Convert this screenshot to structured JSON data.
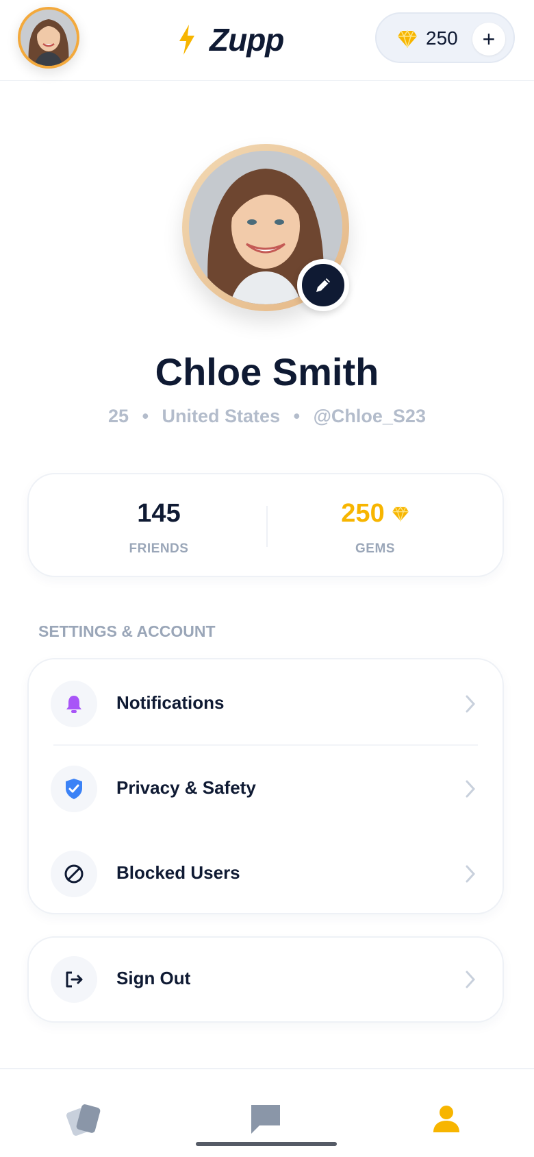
{
  "header": {
    "brand_name": "Zupp",
    "gem_count": "250",
    "add_gems_label": "+"
  },
  "profile": {
    "name": "Chloe Smith",
    "age": "25",
    "country": "United States",
    "handle": "@Chloe_S23",
    "separator": "•"
  },
  "stats": {
    "friends_value": "145",
    "friends_label": "FRIENDS",
    "gems_value": "250",
    "gems_label": "GEMS"
  },
  "settings": {
    "section_title": "SETTINGS & ACCOUNT",
    "items": [
      {
        "label": "Notifications",
        "icon": "bell-icon"
      },
      {
        "label": "Privacy & Safety",
        "icon": "shield-check-icon"
      },
      {
        "label": "Blocked Users",
        "icon": "block-icon"
      }
    ],
    "sign_out_label": "Sign Out"
  },
  "bottom_nav": {
    "items": [
      {
        "icon": "cards-icon",
        "active": false
      },
      {
        "icon": "chat-icon",
        "active": false
      },
      {
        "icon": "profile-icon",
        "active": true
      }
    ]
  },
  "colors": {
    "accent_gold": "#f7b500",
    "primary_navy": "#0f1a33",
    "muted_gray": "#9aa6b8",
    "bell_purple": "#a855f7",
    "shield_blue": "#3b82f6"
  }
}
